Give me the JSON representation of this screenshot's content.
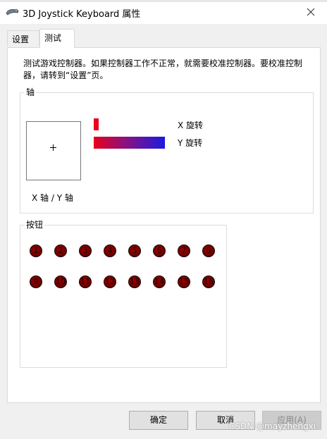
{
  "window": {
    "title": "3D Joystick Keyboard 属性",
    "icon": "joystick-icon"
  },
  "tabs": [
    {
      "label": "设置",
      "active": false
    },
    {
      "label": "测试",
      "active": true
    }
  ],
  "description": "测试游戏控制器。如果控制器工作不正常，就需要校准控制器。要校准控制器，请转到“设置”页。",
  "axis_group": {
    "title": "轴",
    "xy_label": "X 轴 / Y 轴",
    "x_rotation_label": "X 旋转",
    "y_rotation_label": "Y 旋转"
  },
  "buttons_group": {
    "title": "按钮",
    "buttons": [
      "1",
      "2",
      "3",
      "4",
      "5",
      "6",
      "7",
      "8",
      "9",
      "10",
      "11",
      "12",
      "13",
      "14",
      "15",
      "16"
    ]
  },
  "footer": {
    "ok": "确定",
    "cancel": "取消",
    "apply": "应用(A)"
  },
  "watermark": "CSDN @mayzhengxi",
  "colors": {
    "bar_start": "#e8001c",
    "bar_end": "#1c1adf",
    "button_fill": "#7a0000"
  }
}
